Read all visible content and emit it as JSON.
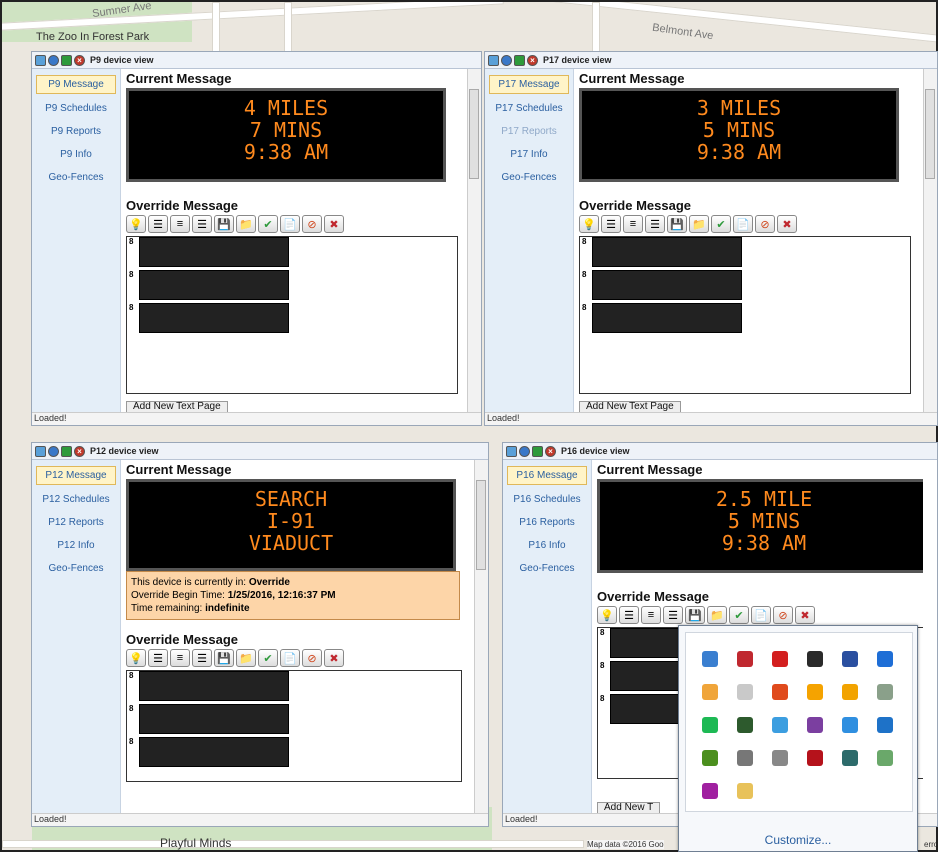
{
  "map": {
    "labels": [
      "Sumner Ave",
      "The Zoo In Forest Park",
      "Belmont Ave",
      "Playful Minds",
      "Map data ©2016 Goo"
    ],
    "corner_text": "erro"
  },
  "windows": [
    {
      "title": "P9 device view",
      "nav": [
        "P9 Message",
        "P9 Schedules",
        "P9 Reports",
        "P9 Info",
        "Geo-Fences"
      ],
      "current_label": "Current Message",
      "sign_lines": [
        "4 MILES",
        "7 MINS",
        "9:38 AM"
      ],
      "override_label": "Override Message",
      "line_numbers": [
        "8",
        "8",
        "8"
      ],
      "add_page": "Add New Text Page",
      "status": "Loaded!"
    },
    {
      "title": "P17 device view",
      "nav": [
        "P17 Message",
        "P17 Schedules",
        "P17 Reports",
        "P17 Info",
        "Geo-Fences"
      ],
      "current_label": "Current Message",
      "sign_lines": [
        "3 MILES",
        "5 MINS",
        "9:38 AM"
      ],
      "override_label": "Override Message",
      "line_numbers": [
        "8",
        "8",
        "8"
      ],
      "add_page": "Add New Text Page",
      "status": "Loaded!"
    },
    {
      "title": "P12 device view",
      "nav": [
        "P12 Message",
        "P12 Schedules",
        "P12 Reports",
        "P12 Info",
        "Geo-Fences"
      ],
      "current_label": "Current Message",
      "sign_lines": [
        "SEARCH",
        "I-91",
        "VIADUCT"
      ],
      "override_info": {
        "line1_prefix": "This device is currently in: ",
        "line1_value": "Override",
        "line2_prefix": "Override Begin Time: ",
        "line2_value": "1/25/2016, 12:16:37 PM",
        "line3_prefix": "Time remaining: ",
        "line3_value": "indefinite"
      },
      "override_label": "Override Message",
      "line_numbers": [
        "8",
        "8",
        "8"
      ],
      "status": "Loaded!"
    },
    {
      "title": "P16 device view",
      "nav": [
        "P16 Message",
        "P16 Schedules",
        "P16 Reports",
        "P16 Info",
        "Geo-Fences"
      ],
      "current_label": "Current Message",
      "sign_lines": [
        "2.5 MILE",
        "5 MINS",
        "9:38 AM"
      ],
      "override_label": "Override Message",
      "line_numbers": [
        "8",
        "8",
        "8"
      ],
      "add_page": "Add New T",
      "status": "Loaded!"
    }
  ],
  "toolbar_icons": [
    "lightbulb-icon",
    "align-left-icon",
    "align-center-icon",
    "align-right-icon",
    "save-icon",
    "open-folder-icon",
    "check-icon",
    "new-page-icon",
    "stop-icon",
    "delete-icon"
  ],
  "toolbar_glyphs": [
    "💡",
    "☰",
    "≡",
    "☰",
    "💾",
    "📁",
    "✔",
    "📄",
    "⊘",
    "✖"
  ],
  "tray": {
    "customize_label": "Customize...",
    "icons": [
      {
        "name": "network-icon",
        "color": "#3a7fd0"
      },
      {
        "name": "shield-icon",
        "color": "#c0282f"
      },
      {
        "name": "adobe-icon",
        "color": "#d31f1f"
      },
      {
        "name": "dock-icon",
        "color": "#2a2a2a"
      },
      {
        "name": "calendar-icon",
        "color": "#2a4fa0"
      },
      {
        "name": "sync-icon",
        "color": "#1e6ed6"
      },
      {
        "name": "cheese-icon",
        "color": "#f0a53a"
      },
      {
        "name": "monitor-icon",
        "color": "#c9c9c9"
      },
      {
        "name": "swirl-icon",
        "color": "#e04a1c"
      },
      {
        "name": "office-icon",
        "color": "#f5a300"
      },
      {
        "name": "circle-arrow-icon",
        "color": "#f2a300"
      },
      {
        "name": "gear-cluster-icon",
        "color": "#8aa08a"
      },
      {
        "name": "spotify-icon",
        "color": "#1db954"
      },
      {
        "name": "chart-icon",
        "color": "#2d5a2d"
      },
      {
        "name": "person-icon",
        "color": "#3c9ee0"
      },
      {
        "name": "onenote-icon",
        "color": "#7b3fa0"
      },
      {
        "name": "cog-icon",
        "color": "#2f8fe0"
      },
      {
        "name": "butterfly-icon",
        "color": "#1e72c8"
      },
      {
        "name": "nvidia-icon",
        "color": "#4b8f1e"
      },
      {
        "name": "clipboard-icon",
        "color": "#777777"
      },
      {
        "name": "flag-icon",
        "color": "#888888"
      },
      {
        "name": "mcafee-icon",
        "color": "#b5121b"
      },
      {
        "name": "usb-icon",
        "color": "#2d6b6b"
      },
      {
        "name": "drive-check-icon",
        "color": "#6aa86a"
      },
      {
        "name": "headset-icon",
        "color": "#a020a0"
      },
      {
        "name": "mail-icon",
        "color": "#e8c25a"
      }
    ]
  }
}
